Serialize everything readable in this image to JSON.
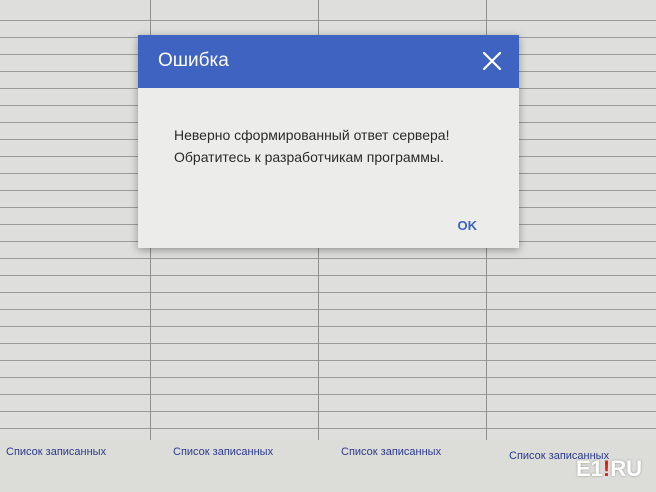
{
  "dialog": {
    "title": "Ошибка",
    "message_line1": "Неверно сформированный ответ сервера!",
    "message_line2": "Обратитесь к разработчикам программы.",
    "ok_label": "OK",
    "header_color": "#3f63c0"
  },
  "footer": {
    "links": [
      "Список записанных",
      "Список записанных",
      "Список записанных",
      "Список записанных"
    ]
  },
  "watermark": {
    "logo_text_left": "E1",
    "logo_mark": "!",
    "logo_text_right": "RU"
  },
  "icons": {
    "close": "close-icon"
  }
}
